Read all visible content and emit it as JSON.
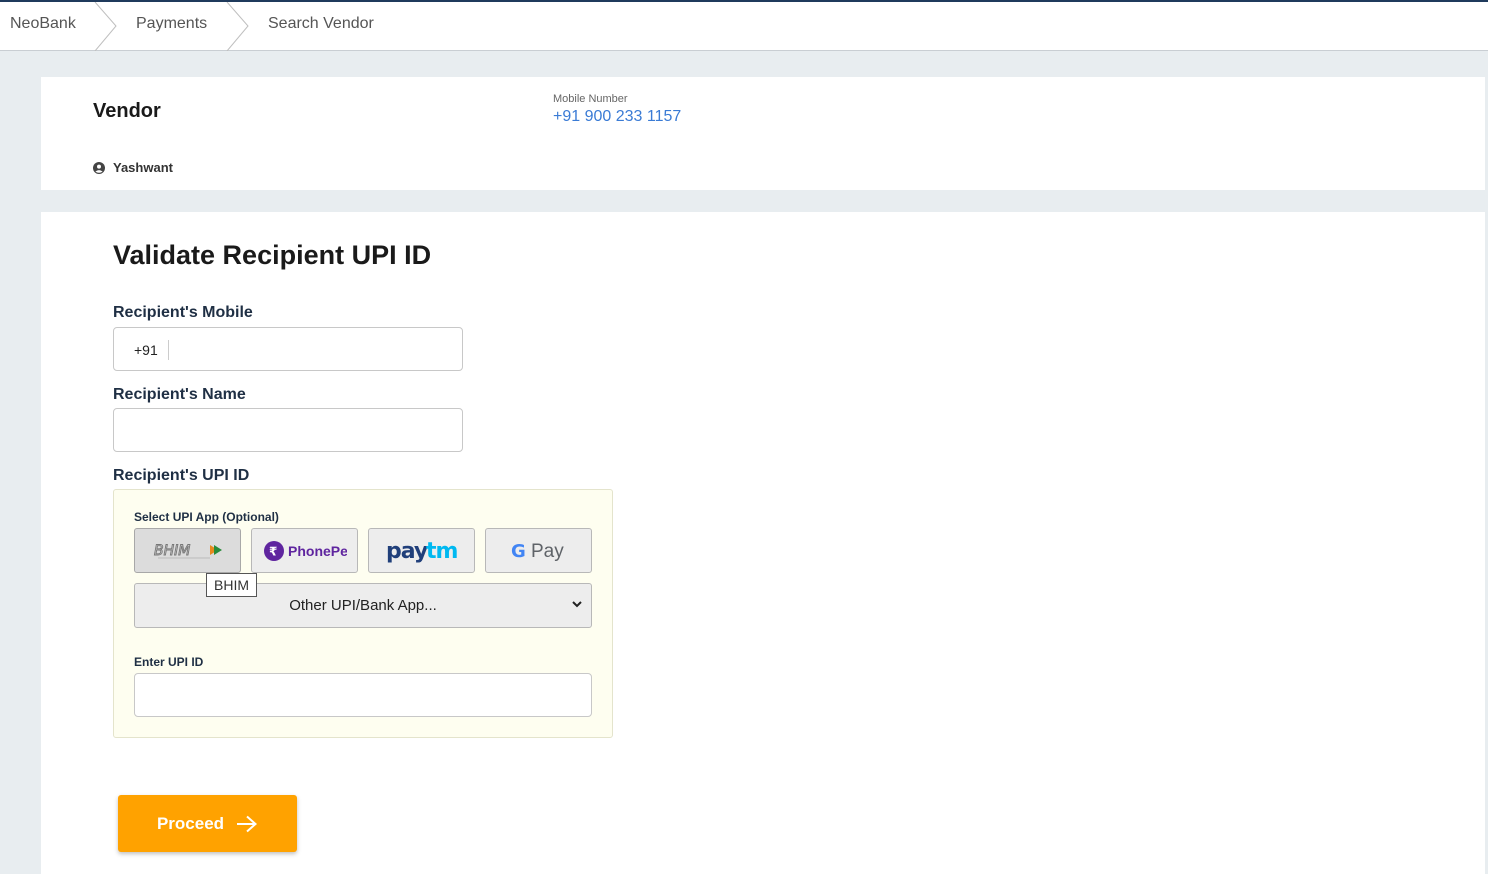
{
  "breadcrumb": {
    "items": [
      {
        "label": "NeoBank"
      },
      {
        "label": "Payments"
      },
      {
        "label": "Search Vendor"
      }
    ]
  },
  "vendor": {
    "title": "Vendor",
    "user_name": "Yashwant",
    "user_icon": "user-circle-icon",
    "mobile_label": "Mobile Number",
    "mobile_value": "+91 900 233 1157"
  },
  "form": {
    "title": "Validate Recipient UPI ID",
    "mobile_label": "Recipient's Mobile",
    "mobile_prefix": "+91",
    "mobile_value": "",
    "name_label": "Recipient's Name",
    "name_value": "",
    "upi_label": "Recipient's UPI ID",
    "select_app_label": "Select UPI App (Optional)",
    "apps": [
      {
        "name": "BHIM",
        "logo": "BHIM",
        "active": true
      },
      {
        "name": "PhonePe",
        "logo": "PhonePe",
        "active": false
      },
      {
        "name": "Paytm",
        "logo": "Paytm",
        "active": false
      },
      {
        "name": "Google Pay",
        "logo": "G Pay",
        "active": false
      }
    ],
    "tooltip": "BHIM",
    "other_app_select": "Other UPI/Bank App...",
    "enter_upi_label": "Enter UPI ID",
    "upi_value": "",
    "proceed_label": "Proceed",
    "proceed_icon": "arrow-right-icon"
  },
  "colors": {
    "accent": "#ffa200",
    "link": "#3a7bd5",
    "header_border": "#1f3a5c",
    "upi_panel_bg": "#fefef0"
  }
}
